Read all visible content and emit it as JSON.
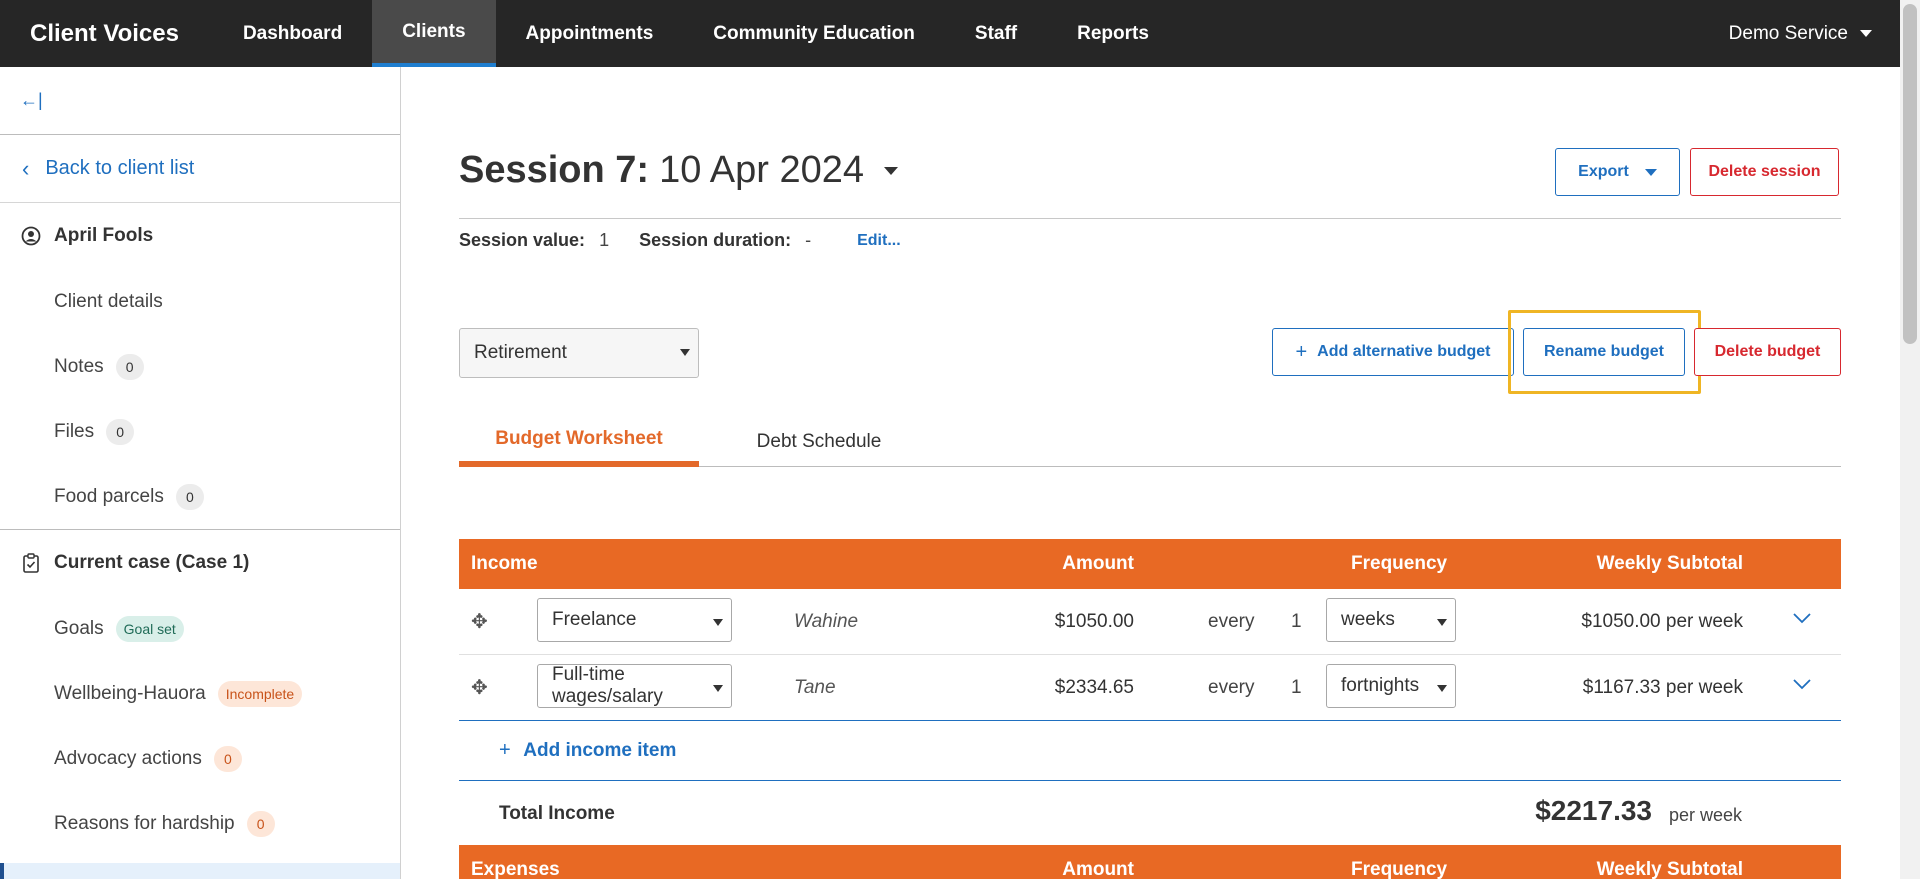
{
  "app": {
    "brand": "Client Voices",
    "account": "Demo Service"
  },
  "nav": [
    {
      "label": "Dashboard"
    },
    {
      "label": "Clients"
    },
    {
      "label": "Appointments"
    },
    {
      "label": "Community Education"
    },
    {
      "label": "Staff"
    },
    {
      "label": "Reports"
    }
  ],
  "sidebar": {
    "collapse_icon": "←|",
    "back_label": "Back to client list",
    "client_name": "April Fools",
    "client_items": [
      {
        "label": "Client details"
      },
      {
        "label": "Notes",
        "count": "0"
      },
      {
        "label": "Files",
        "count": "0"
      },
      {
        "label": "Food parcels",
        "count": "0"
      }
    ],
    "case_title": "Current case (Case 1)",
    "case_items": [
      {
        "label": "Goals",
        "badge": "Goal set"
      },
      {
        "label": "Wellbeing-Hauora",
        "badge": "Incomplete"
      },
      {
        "label": "Advocacy actions",
        "count": "0"
      },
      {
        "label": "Reasons for hardship",
        "count": "0"
      }
    ]
  },
  "session": {
    "title_strong": "Session 7:",
    "title_date": "10 Apr 2024",
    "export_label": "Export",
    "delete_session_label": "Delete session",
    "value_label": "Session value:",
    "value": "1",
    "duration_label": "Session duration:",
    "duration": "-",
    "edit_label": "Edit..."
  },
  "budget": {
    "selected": "Retirement",
    "add_alt_label": "Add alternative budget",
    "rename_label": "Rename budget",
    "delete_label": "Delete budget"
  },
  "tabs": [
    {
      "label": "Budget Worksheet",
      "active": true
    },
    {
      "label": "Debt Schedule",
      "active": false
    }
  ],
  "income": {
    "headers": {
      "name": "Income",
      "amount": "Amount",
      "frequency": "Frequency",
      "subtotal": "Weekly Subtotal"
    },
    "rows": [
      {
        "type": "Freelance",
        "who": "Wahine",
        "amount": "$1050.00",
        "every": "every",
        "n": "1",
        "unit": "weeks",
        "subtotal": "$1050.00 per week"
      },
      {
        "type": "Full-time wages/salary",
        "who": "Tane",
        "amount": "$2334.65",
        "every": "every",
        "n": "1",
        "unit": "fortnights",
        "subtotal": "$1167.33 per week"
      }
    ],
    "add_label": "Add income item",
    "total_label": "Total Income",
    "total_value": "$2217.33",
    "total_unit": "per week"
  },
  "expenses": {
    "headers": {
      "name": "Expenses",
      "amount": "Amount",
      "frequency": "Frequency",
      "subtotal": "Weekly Subtotal"
    }
  },
  "colors": {
    "accent": "#e86924",
    "link": "#1f6fbf",
    "danger": "#d7282f",
    "nav": "#262626",
    "highlight": "#efb524"
  }
}
